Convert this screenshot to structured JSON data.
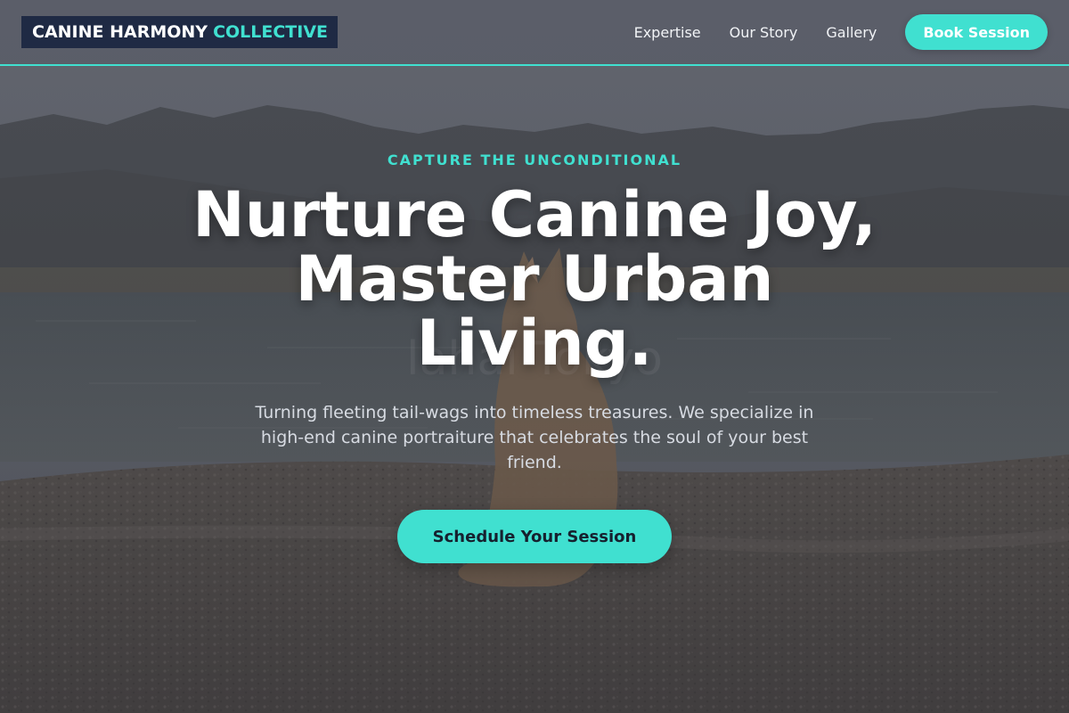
{
  "brand": {
    "name_main": "CANINE HARMONY",
    "name_accent": "COLLECTIVE"
  },
  "nav": {
    "links": [
      "Expertise",
      "Our Story",
      "Gallery"
    ],
    "cta_label": "Book Session"
  },
  "hero": {
    "eyebrow": "CAPTURE THE UNCONDITIONAL",
    "headline": "Nurture Canine Joy, Master Urban Living.",
    "subtext": "Turning fleeting tail-wags into timeless treasures. We specialize in high-end canine portraiture that celebrates the soul of your best friend.",
    "cta_label": "Schedule Your Session"
  },
  "colors": {
    "accent": "#40e0d0",
    "logo_bg": "#1f2a44",
    "text_light": "#ffffff"
  }
}
